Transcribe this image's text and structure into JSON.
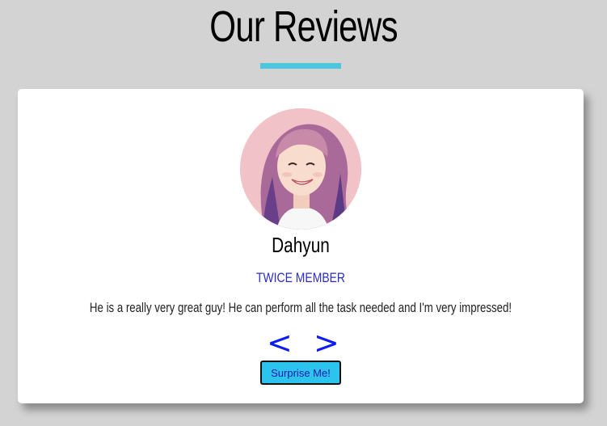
{
  "header": {
    "title": "Our Reviews",
    "accent_color": "#4ec6df"
  },
  "review": {
    "avatar_alt": "Dahyun",
    "name": "Dahyun",
    "role": "TWICE MEMBER",
    "text": "He is a really very great guy! He can perform all the task needed and I'm very impressed!"
  },
  "controls": {
    "prev_label": "<",
    "next_label": ">",
    "surprise_label": "Surprise Me!",
    "nav_color": "#0b1cf5",
    "button_color": "#2cc4ec"
  }
}
